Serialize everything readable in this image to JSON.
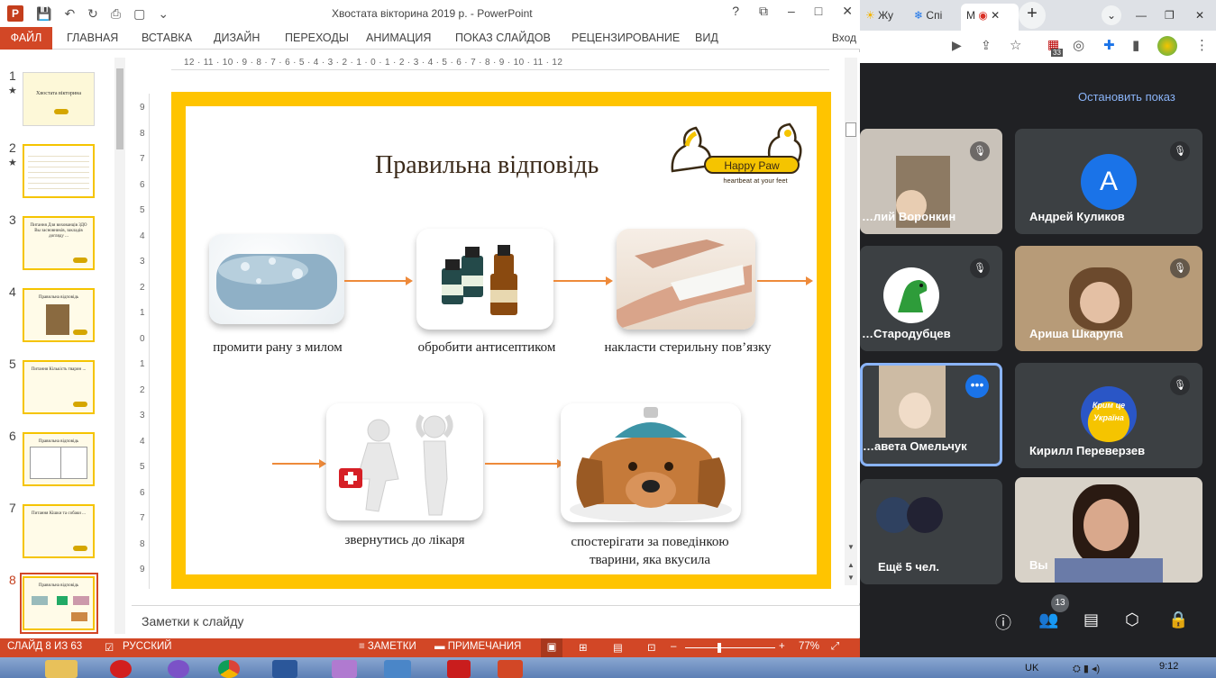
{
  "powerpoint": {
    "window_title": "Хвостата вікторина 2019 р. - PowerPoint",
    "logo": "P",
    "qat_icons": [
      "save-icon",
      "undo-icon",
      "redo-icon",
      "preview-icon",
      "new-icon",
      "more-icon"
    ],
    "ribbon_tabs": [
      "ФАЙЛ",
      "ГЛАВНАЯ",
      "ВСТАВКА",
      "ДИЗАЙН",
      "ПЕРЕХОДЫ",
      "АНИМАЦИЯ",
      "ПОКАЗ СЛАЙДОВ",
      "РЕЦЕНЗИРОВАНИЕ",
      "ВИД"
    ],
    "signin": "Вход",
    "window_controls": [
      "?",
      "⧉",
      "–",
      "□",
      "✕"
    ],
    "ruler_top": "12 · 11 · 10 · 9 · 8 · 7 · 6 · 5 · 4 · 3 · 2 · 1 · 0 · 1 · 2 · 3 · 4 · 5 · 6 · 7 · 8 · 9 · 10 · 11 · 12",
    "ruler_left": [
      "9",
      "8",
      "7",
      "6",
      "5",
      "4",
      "3",
      "2",
      "1",
      "0",
      "1",
      "2",
      "3",
      "4",
      "5",
      "6",
      "7",
      "8",
      "9"
    ],
    "thumbnails": [
      {
        "num": "1",
        "star": "★",
        "text": "Хвостата вікторина"
      },
      {
        "num": "2",
        "star": "★",
        "text": ""
      },
      {
        "num": "3",
        "star": "",
        "text": "Питання Для вихованців ЗДО Вы засновників, закладів догляду ..."
      },
      {
        "num": "4",
        "star": "",
        "text": "Правильна відповідь"
      },
      {
        "num": "5",
        "star": "",
        "text": "Питання Кількість тварин ..."
      },
      {
        "num": "6",
        "star": "",
        "text": "Правильна відповідь"
      },
      {
        "num": "7",
        "star": "",
        "text": "Питання Кішки та собаки ..."
      },
      {
        "num": "8",
        "star": "",
        "text": "Правильна відповідь"
      }
    ],
    "slide": {
      "title": "Правильна відповідь",
      "logo_text": "Happy Paw",
      "logo_tagline": "heartbeat at your feet",
      "steps": [
        {
          "caption": "промити рану з милом",
          "icon": "soap-image"
        },
        {
          "caption": "обробити антисептиком",
          "icon": "antiseptic-image"
        },
        {
          "caption": "накласти стерильну пов’язку",
          "icon": "bandage-image"
        },
        {
          "caption": "звернутись до лікаря",
          "icon": "doctor-image"
        },
        {
          "caption_line1": "спостерігати за поведінкою",
          "caption_line2": "тварини, яка вкусила",
          "icon": "dog-image"
        }
      ]
    },
    "notes_placeholder": "Заметки к слайду",
    "status": {
      "slide_counter": "СЛАЙД 8 ИЗ 63",
      "language": "РУССКИЙ",
      "notes_btn": "ЗАМЕТКИ",
      "comments_btn": "ПРИМЕЧАНИЯ",
      "zoom": "77%"
    }
  },
  "chrome": {
    "tabs": [
      "Жу",
      "Спі",
      "М"
    ],
    "new_tab": "+",
    "ext_badge": "33"
  },
  "meet": {
    "stop_presenting": "Остановить показ",
    "participants": [
      {
        "name": "…лий Воронкин",
        "type": "video"
      },
      {
        "name": "Андрей Куликов",
        "type": "avatar",
        "letter": "A",
        "color": "#1a73e8"
      },
      {
        "name": "…Стародубцев",
        "type": "video"
      },
      {
        "name": "Ариша Шкарупа",
        "type": "video"
      },
      {
        "name": "…авета Омельчук",
        "type": "video"
      },
      {
        "name": "Кирилл Переверзев",
        "type": "avatar",
        "letter": "",
        "color": "#2a56c6"
      },
      {
        "name": "Ещё 5 чел.",
        "type": "more"
      },
      {
        "name": "Вы",
        "type": "video"
      }
    ],
    "participants_count": "13",
    "crimea_badge": "Крим це Україна"
  },
  "taskbar": {
    "lang": "UK",
    "time": "9:12"
  }
}
